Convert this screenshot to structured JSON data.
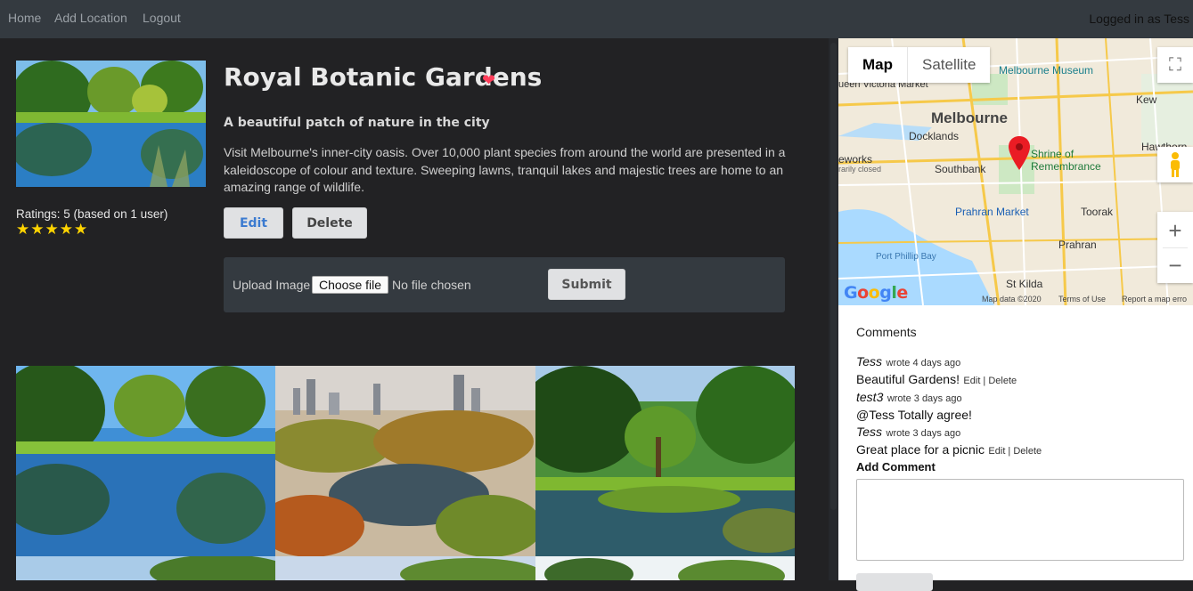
{
  "nav": {
    "links": [
      "Home",
      "Add Location",
      "Logout"
    ],
    "status": "Logged in as Tess"
  },
  "location": {
    "title": "Royal Botanic Gardens",
    "subtitle": "A beautiful patch of nature in the city",
    "description": "Visit Melbourne's inner-city oasis. Over 10,000 plant species from around the world are presented in a kaleidoscope of colour and texture. Sweeping lawns, tranquil lakes and majestic trees are home to an amazing range of wildlife.",
    "ratings_text": "Ratings: 5 (based on 1 user)",
    "stars": "★★★★★",
    "heart": "❤",
    "edit_label": "Edit",
    "delete_label": "Delete"
  },
  "upload": {
    "label": "Upload Image",
    "file_button": "Choose file",
    "file_status": "No file chosen",
    "submit_label": "Submit"
  },
  "map": {
    "tab_map": "Map",
    "tab_satellite": "Satellite",
    "city": "Melbourne",
    "places": [
      "Melbourne Museum",
      "ueen Victoria Market",
      "Docklands",
      "Southbank",
      "Shrine of Remembrance",
      "Prahran Market",
      "Toorak",
      "Prahran",
      "Port Phillip Bay",
      "St Kilda",
      "Kew",
      "Hawthorn",
      "eworks",
      "rarily closed"
    ],
    "footer_data": "Map data ©2020",
    "footer_terms": "Terms of Use",
    "footer_report": "Report a map erro",
    "google": "Google",
    "zoom_in": "+",
    "zoom_out": "−",
    "fullscreen": "⛶"
  },
  "comments": {
    "heading": "Comments",
    "items": [
      {
        "author": "Tess",
        "meta": "wrote 4 days ago",
        "text": "Beautiful Gardens!",
        "actions": "Edit | Delete"
      },
      {
        "author": "test3",
        "meta": "wrote 3 days ago",
        "text": "@Tess Totally agree!",
        "actions": ""
      },
      {
        "author": "Tess",
        "meta": "wrote 3 days ago",
        "text": "Great place for a picnic",
        "actions": "Edit | Delete"
      }
    ],
    "add_heading": "Add Comment"
  },
  "colors": {
    "navbar": "#343a40",
    "page_bg": "#222224",
    "star": "#ffd400",
    "heart": "#ff3d5a",
    "edit_text": "#3c7bd0"
  }
}
